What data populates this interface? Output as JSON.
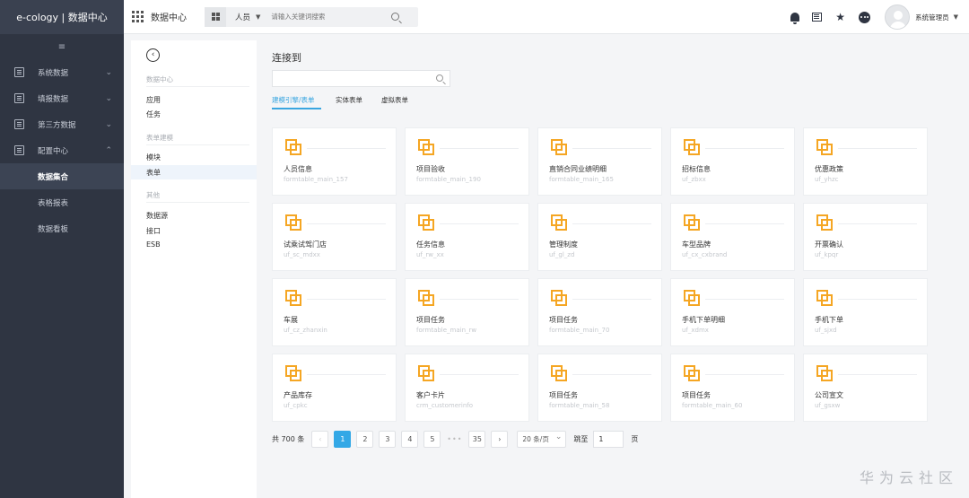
{
  "brand": "e-cology | 数据中心",
  "header": {
    "app_title": "数据中心",
    "search_scope": "人员",
    "search_placeholder": "请输入关键词搜索",
    "username": "系统管理员"
  },
  "sidebar": {
    "collapse_icon": "≡",
    "items": [
      {
        "label": "系统数据"
      },
      {
        "label": "填报数据"
      },
      {
        "label": "第三方数据"
      },
      {
        "label": "配置中心"
      }
    ],
    "sub_items": [
      {
        "label": "数据集合"
      },
      {
        "label": "表格报表"
      },
      {
        "label": "数据看板"
      }
    ]
  },
  "panel": {
    "group1": "数据中心",
    "items1": [
      "应用",
      "任务"
    ],
    "group2": "表单建模",
    "items2": [
      "模块",
      "表单"
    ],
    "group3": "其他",
    "items3": [
      "数据源",
      "接口",
      "ESB"
    ]
  },
  "main": {
    "title": "连接到",
    "search_placeholder": "",
    "tabs": [
      "建模引擎/表单",
      "实体表单",
      "虚拟表单"
    ]
  },
  "cards": [
    {
      "name": "人员信息",
      "sub": "formtable_main_157"
    },
    {
      "name": "项目验收",
      "sub": "formtable_main_190"
    },
    {
      "name": "直销合同业绩明细",
      "sub": "formtable_main_165"
    },
    {
      "name": "招标信息",
      "sub": "uf_zbxx"
    },
    {
      "name": "优惠政策",
      "sub": "uf_yhzc"
    },
    {
      "name": "试乘试驾门店",
      "sub": "uf_sc_mdxx"
    },
    {
      "name": "任务信息",
      "sub": "uf_rw_xx"
    },
    {
      "name": "管理制度",
      "sub": "uf_gl_zd"
    },
    {
      "name": "车型品牌",
      "sub": "uf_cx_cxbrand"
    },
    {
      "name": "开票确认",
      "sub": "uf_kpqr"
    },
    {
      "name": "车展",
      "sub": "uf_cz_zhanxin"
    },
    {
      "name": "项目任务",
      "sub": "formtable_main_rw"
    },
    {
      "name": "项目任务",
      "sub": "formtable_main_70"
    },
    {
      "name": "手机下单明细",
      "sub": "uf_xdmx"
    },
    {
      "name": "手机下单",
      "sub": "uf_sjxd"
    },
    {
      "name": "产品库存",
      "sub": "uf_cpkc"
    },
    {
      "name": "客户卡片",
      "sub": "crm_customerinfo"
    },
    {
      "name": "项目任务",
      "sub": "formtable_main_58"
    },
    {
      "name": "项目任务",
      "sub": "formtable_main_60"
    },
    {
      "name": "公司宣文",
      "sub": "uf_gsxw"
    }
  ],
  "pager": {
    "total": "共 700 条",
    "prev": "‹",
    "pages": [
      "1",
      "2",
      "3",
      "4",
      "5"
    ],
    "ellipsis": "•••",
    "last": "35",
    "next": "›",
    "size": "20 条/页",
    "jump_label": "跳至",
    "jump_value": "1",
    "page_label": "页"
  },
  "watermark": "华为云社区",
  "colors": {
    "accent": "#3aa6e0",
    "icon": "#f5a623",
    "sidebar": "#2f3542"
  }
}
